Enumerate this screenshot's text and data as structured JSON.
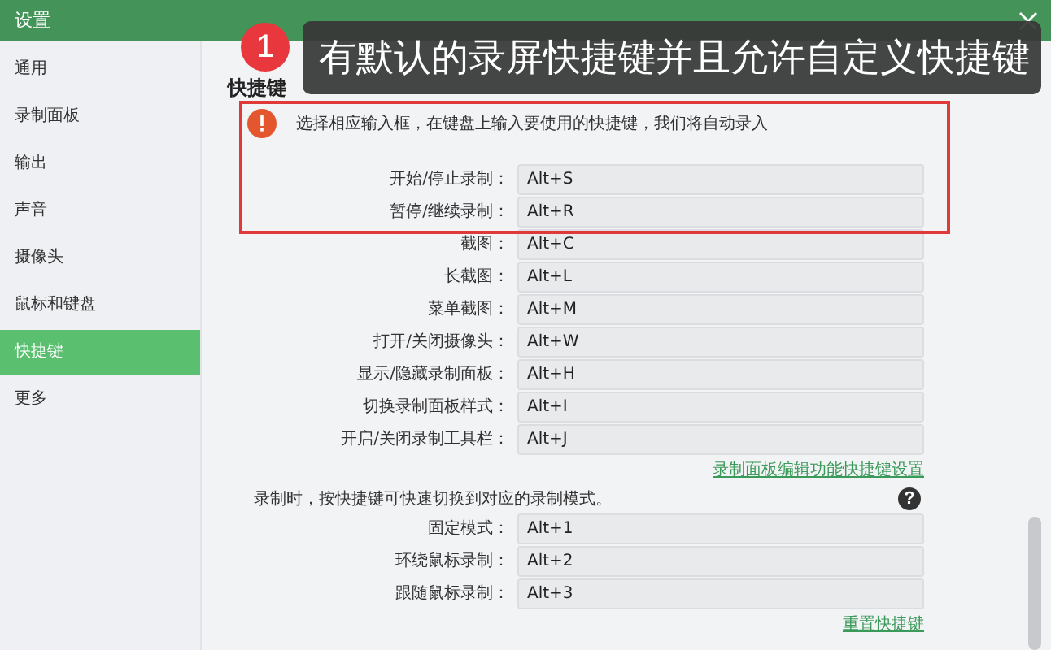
{
  "window": {
    "title": "设置"
  },
  "sidebar": {
    "items": [
      {
        "label": "通用",
        "selected": false
      },
      {
        "label": "录制面板",
        "selected": false
      },
      {
        "label": "输出",
        "selected": false
      },
      {
        "label": "声音",
        "selected": false
      },
      {
        "label": "摄像头",
        "selected": false
      },
      {
        "label": "鼠标和键盘",
        "selected": false
      },
      {
        "label": "快捷键",
        "selected": true
      },
      {
        "label": "更多",
        "selected": false
      }
    ]
  },
  "section": {
    "heading": "快捷键",
    "notice": "选择相应输入框，在键盘上输入要使用的快捷键，我们将自动录入",
    "shortcuts": [
      {
        "label": "开始/停止录制：",
        "value": "Alt+S"
      },
      {
        "label": "暂停/继续录制：",
        "value": "Alt+R"
      },
      {
        "label": "截图：",
        "value": "Alt+C"
      },
      {
        "label": "长截图：",
        "value": "Alt+L"
      },
      {
        "label": "菜单截图：",
        "value": "Alt+M"
      },
      {
        "label": "打开/关闭摄像头：",
        "value": "Alt+W"
      },
      {
        "label": "显示/隐藏录制面板：",
        "value": "Alt+H"
      },
      {
        "label": "切换录制面板样式：",
        "value": "Alt+I"
      },
      {
        "label": "开启/关闭录制工具栏：",
        "value": "Alt+J"
      }
    ],
    "edit_link": "录制面板编辑功能快捷键设置",
    "mode_note": "录制时，按快捷键可快速切换到对应的录制模式。",
    "help_icon": "?",
    "mode_shortcuts": [
      {
        "label": "固定模式：",
        "value": "Alt+1"
      },
      {
        "label": "环绕鼠标录制：",
        "value": "Alt+2"
      },
      {
        "label": "跟随鼠标录制：",
        "value": "Alt+3"
      }
    ],
    "reset_link": "重置快捷键"
  },
  "annotation": {
    "badge": "1",
    "text": "有默认的录屏快捷键并且允许自定义快捷键",
    "highlight": true
  }
}
